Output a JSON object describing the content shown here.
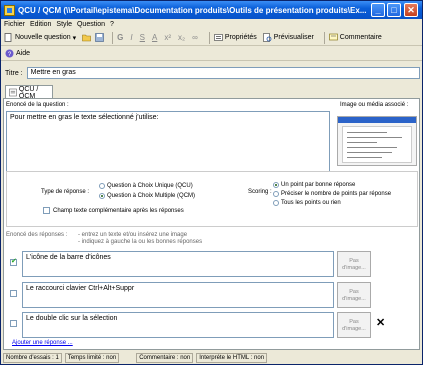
{
  "window": {
    "title": "QCU / QCM (\\\\Portail\\epistema\\Documentation produits\\Outils de présentation produits\\Ex...",
    "buttons": {
      "minimize": "_",
      "maximize": "□",
      "close": "✕"
    }
  },
  "menu": [
    "Fichier",
    "Edition",
    "Style",
    "Question",
    "?"
  ],
  "toolbar": {
    "new_question": "Nouvelle question",
    "format_glyphs": [
      "G",
      "I",
      "S",
      "A",
      "x²",
      "x₂",
      "∞"
    ],
    "properties": "Propriétés",
    "preview": "Prévisualiser",
    "comment": "Commentaire"
  },
  "toolbar2": {
    "help": "Aide"
  },
  "titre": {
    "label": "Titre :",
    "value": "Mettre en gras"
  },
  "tab": {
    "label": "QCU / QCM"
  },
  "question": {
    "label": "Enoncé de la question :",
    "text": "Pour mettre en gras le texte sélectionné j'utilise:",
    "media_label": "Image ou média associé :"
  },
  "response_type": {
    "label": "Type de réponse :",
    "options": [
      "Question à Choix Unique (QCU)",
      "Question à Choix Multiple (QCM)"
    ],
    "selected": 1,
    "complement": "Champ texte complémentaire après les réponses"
  },
  "scoring": {
    "label": "Scoring :",
    "options": [
      "Un point par bonne réponse",
      "Préciser le nombre de points par réponse",
      "Tous les points ou rien"
    ],
    "selected": 0
  },
  "answers_hint": {
    "label": "Enoncé des réponses :",
    "line1": "- entrez un texte et/ou insérez une image",
    "line2": "- indiquez à gauche la ou les bonnes réponses"
  },
  "answers": [
    {
      "text": "L'icône de la barre d'icônes",
      "correct": true,
      "image": "Pas d'image..."
    },
    {
      "text": "Le raccourci clavier Ctrl+Alt+Suppr",
      "correct": false,
      "image": "Pas d'image..."
    },
    {
      "text": "Le double clic sur la sélection",
      "correct": false,
      "image": "Pas d'image..."
    }
  ],
  "add_answer": "Ajouter une réponse ...",
  "status": {
    "essais": "Nombre d'essais : 1",
    "temps": "Temps limité : non",
    "commentaire": "Commentaire : non",
    "html": "Interpréte le HTML : non"
  },
  "colors": {
    "title_bar": "#0a5fd9",
    "correct_check": "#21a121",
    "link": "#0000ee"
  }
}
